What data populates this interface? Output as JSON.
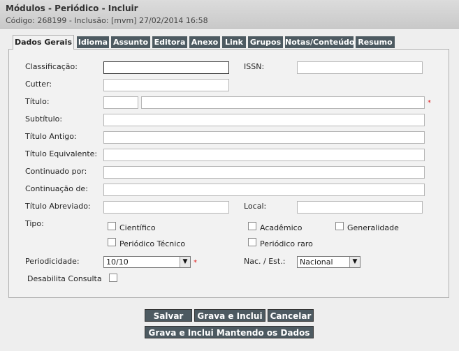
{
  "header": {
    "title": "Módulos - Periódico - Incluir",
    "subtitle": "Código: 268199 - Inclusão: [mvm] 27/02/2014 16:58"
  },
  "tabs": [
    {
      "label": "Dados Gerais",
      "active": true
    },
    {
      "label": "Idioma"
    },
    {
      "label": "Assunto"
    },
    {
      "label": "Editora"
    },
    {
      "label": "Anexo"
    },
    {
      "label": "Link"
    },
    {
      "label": "Grupos"
    },
    {
      "label": "Notas/Conteúdo"
    },
    {
      "label": "Resumo"
    }
  ],
  "form": {
    "classificacao": {
      "label": "Classificação:",
      "value": ""
    },
    "issn": {
      "label": "ISSN:",
      "value": ""
    },
    "cutter": {
      "label": "Cutter:",
      "value": ""
    },
    "titulo": {
      "label": "Título:",
      "value_prefix": "",
      "value": "",
      "required": "*"
    },
    "subtitulo": {
      "label": "Subtítulo:",
      "value": ""
    },
    "titulo_antigo": {
      "label": "Título Antigo:",
      "value": ""
    },
    "titulo_equivalente": {
      "label": "Título Equivalente:",
      "value": ""
    },
    "continuado_por": {
      "label": "Continuado por:",
      "value": ""
    },
    "continuacao_de": {
      "label": "Continuação de:",
      "value": ""
    },
    "titulo_abreviado": {
      "label": "Título Abreviado:",
      "value": ""
    },
    "local": {
      "label": "Local:",
      "value": ""
    },
    "tipo": {
      "label": "Tipo:",
      "options": [
        {
          "label": "Científico",
          "checked": false
        },
        {
          "label": "Acadêmico",
          "checked": false
        },
        {
          "label": "Generalidade",
          "checked": false
        },
        {
          "label": "Periódico Técnico",
          "checked": false
        },
        {
          "label": "Periódico raro",
          "checked": false
        }
      ]
    },
    "periodicidade": {
      "label": "Periodicidade:",
      "value": "10/10",
      "required": "*"
    },
    "nac_est": {
      "label": "Nac. / Est.:",
      "value": "Nacional"
    },
    "desabilita_consulta": {
      "label": "Desabilita Consulta",
      "checked": false
    }
  },
  "buttons": {
    "salvar": "Salvar",
    "grava_inclui": "Grava e Inclui",
    "cancelar": "Cancelar",
    "grava_inclui_mantendo": "Grava e Inclui Mantendo os Dados"
  },
  "icons": {
    "dropdown_arrow": "▼"
  },
  "colors": {
    "tab_bg": "#4d5a61",
    "button_bg": "#4d5a61",
    "required": "#e02020"
  }
}
